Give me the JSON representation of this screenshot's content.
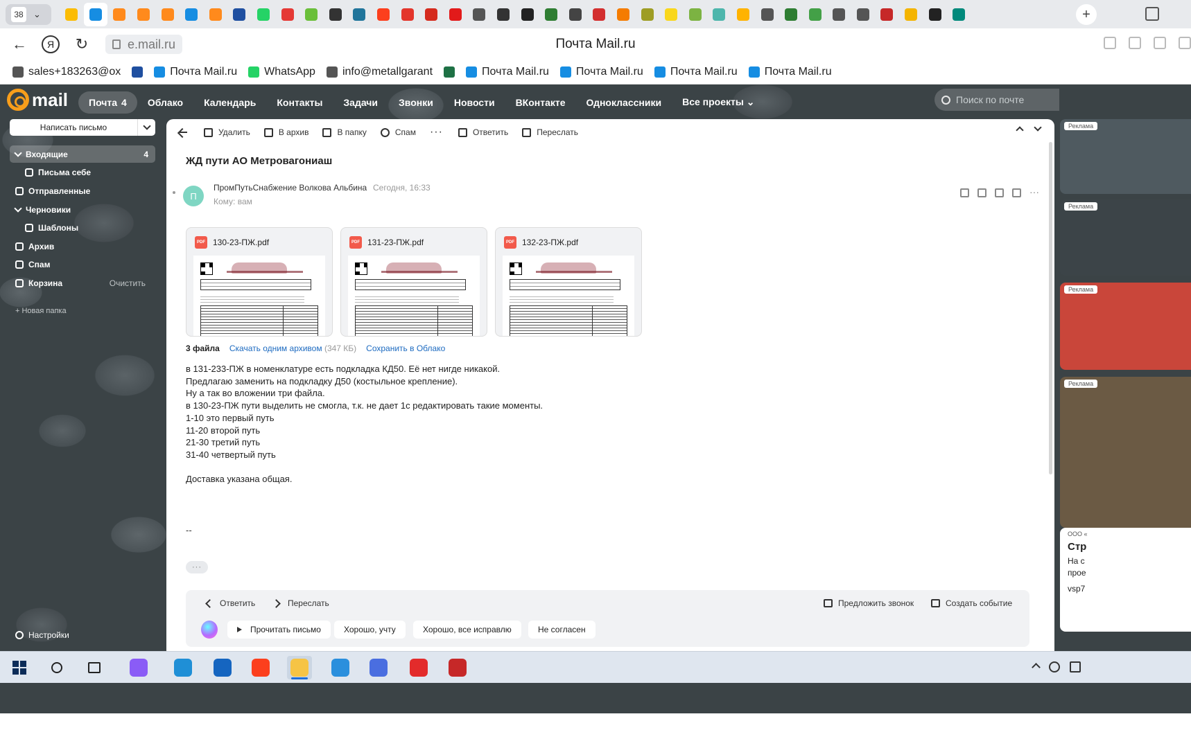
{
  "browser": {
    "tab_count": "38",
    "page_title": "Почта Mail.ru",
    "url": "e.mail.ru",
    "new_tab": "+",
    "tab_icons": [
      {
        "name": "google-drive-icon",
        "color": "#fbbc04"
      },
      {
        "name": "mail-icon",
        "color": "#168de2"
      },
      {
        "name": "cloud-orange-icon",
        "color": "#ff8a1c"
      },
      {
        "name": "cloud-orange-icon",
        "color": "#ff8a1c"
      },
      {
        "name": "cloud-orange-icon",
        "color": "#ff8a1c"
      },
      {
        "name": "mail-icon",
        "color": "#168de2"
      },
      {
        "name": "cloud-orange-icon",
        "color": "#ff8a1c"
      },
      {
        "name": "sg-logo-icon",
        "color": "#1f4fa0"
      },
      {
        "name": "whatsapp-icon",
        "color": "#25d366"
      },
      {
        "name": "map-pin-icon",
        "color": "#e53935"
      },
      {
        "name": "leaf-icon",
        "color": "#6abf3a"
      },
      {
        "name": "t-circle-icon",
        "color": "#333333"
      },
      {
        "name": "wordpress-icon",
        "color": "#21759b"
      },
      {
        "name": "yandex-icon",
        "color": "#fc3f1d"
      },
      {
        "name": "red-app-icon",
        "color": "#e3352b"
      },
      {
        "name": "els-icon",
        "color": "#d52b1e"
      },
      {
        "name": "rzd-icon",
        "color": "#e21a1a"
      },
      {
        "name": "document-icon",
        "color": "#555555"
      },
      {
        "name": "train-icon",
        "color": "#333333"
      },
      {
        "name": "tools-icon",
        "color": "#222222"
      },
      {
        "name": "mtm-icon",
        "color": "#2e7d32"
      },
      {
        "name": "dsp-icon",
        "color": "#444444"
      },
      {
        "name": "brand-icon",
        "color": "#d32f2f"
      },
      {
        "name": "orange-logo-icon",
        "color": "#f57c00"
      },
      {
        "name": "track-icon",
        "color": "#9e9d24"
      },
      {
        "name": "eco-icon",
        "color": "#f9d71c"
      },
      {
        "name": "chat-icon",
        "color": "#7cb342"
      },
      {
        "name": "gear-blue-icon",
        "color": "#4db6ac"
      },
      {
        "name": "image-icon",
        "color": "#ffb300"
      },
      {
        "name": "document-icon",
        "color": "#555555"
      },
      {
        "name": "green-app-icon",
        "color": "#2e7d32"
      },
      {
        "name": "green-diamond-icon",
        "color": "#43a047"
      },
      {
        "name": "document-icon",
        "color": "#555555"
      },
      {
        "name": "document-icon",
        "color": "#555555"
      },
      {
        "name": "globe-icon",
        "color": "#c62828"
      },
      {
        "name": "mail-yellow-icon",
        "color": "#f4b400"
      },
      {
        "name": "circle-icon",
        "color": "#222222"
      },
      {
        "name": "app-icon",
        "color": "#00897b"
      }
    ],
    "bookmarks": [
      {
        "label": "sales+183263@ox",
        "icon": "document-icon",
        "color": "#555555"
      },
      {
        "label": "",
        "icon": "app-icon",
        "color": "#1f4fa0"
      },
      {
        "label": "Почта Mail.ru",
        "icon": "mail-icon",
        "color": "#168de2"
      },
      {
        "label": "WhatsApp",
        "icon": "whatsapp-icon",
        "color": "#25d366"
      },
      {
        "label": "info@metallgarant",
        "icon": "document-icon",
        "color": "#555555"
      },
      {
        "label": "",
        "icon": "excel-icon",
        "color": "#1e7145"
      },
      {
        "label": "Почта Mail.ru",
        "icon": "mail-icon",
        "color": "#168de2"
      },
      {
        "label": "Почта Mail.ru",
        "icon": "mail-icon",
        "color": "#168de2"
      },
      {
        "label": "Почта Mail.ru",
        "icon": "mail-icon",
        "color": "#168de2"
      },
      {
        "label": "Почта Mail.ru",
        "icon": "mail-at-icon",
        "color": "#168de2"
      }
    ]
  },
  "mail": {
    "logo": "mail",
    "nav": [
      {
        "label": "Почта",
        "count": "4",
        "active": true
      },
      {
        "label": "Облако"
      },
      {
        "label": "Календарь"
      },
      {
        "label": "Контакты"
      },
      {
        "label": "Задачи"
      },
      {
        "label": "Звонки"
      },
      {
        "label": "Новости"
      },
      {
        "label": "ВКонтакте"
      },
      {
        "label": "Одноклассники"
      },
      {
        "label": "Все проекты"
      }
    ],
    "search_placeholder": "Поиск по почте",
    "compose_label": "Написать письмо",
    "folders": [
      {
        "label": "Входящие",
        "count": "4",
        "active": true,
        "icon": "chevron-down-icon"
      },
      {
        "label": "Письма себе",
        "sub": true,
        "icon": "self-mail-icon"
      },
      {
        "label": "Отправленные",
        "icon": "sent-icon"
      },
      {
        "label": "Черновики",
        "icon": "chevron-down-icon"
      },
      {
        "label": "Шаблоны",
        "sub": true,
        "icon": "folder-icon"
      },
      {
        "label": "Архив",
        "icon": "archive-icon"
      },
      {
        "label": "Спам",
        "icon": "spam-icon"
      },
      {
        "label": "Корзина",
        "action": "Очистить",
        "icon": "trash-icon"
      }
    ],
    "new_folder": "+ Новая папка",
    "settings": "Настройки",
    "toolbar": {
      "delete": "Удалить",
      "archive": "В архив",
      "to_folder": "В папку",
      "spam": "Спам",
      "more": "···",
      "reply": "Ответить",
      "forward": "Переслать"
    },
    "message": {
      "subject": "ЖД пути АО Метровагониаш",
      "avatar_letter": "П",
      "sender": "ПромПутьСнабжение Волкова Альбина",
      "date": "Сегодня, 16:33",
      "recipient": "Кому: вам",
      "attachments": [
        {
          "name": "130-23-ПЖ.pdf"
        },
        {
          "name": "131-23-ПЖ.pdf"
        },
        {
          "name": "132-23-ПЖ.pdf"
        }
      ],
      "pdf_badge": "PDF",
      "attach_count": "3 файла",
      "download_all": "Скачать одним архивом",
      "archive_size": "(347 КБ)",
      "save_cloud": "Сохранить в Облако",
      "body_lines": [
        "в 131-233-ПЖ в номенклатуре есть подкладка КД50. Её нет нигде никакой.",
        "Предлагаю заменить на подкладку Д50 (костыльное крепление).",
        "Ну а так во вложении три файла.",
        "в 130-23-ПЖ пути выделить не смогла, т.к. не дает 1с редактировать такие моменты.",
        "1-10 это первый путь",
        "11-20 второй путь",
        "21-30 третий путь",
        "31-40 четвертый путь",
        "",
        "Доставка указана общая."
      ],
      "signature": "--",
      "more_quoted": "···"
    },
    "reply_panel": {
      "reply": "Ответить",
      "forward": "Переслать",
      "suggest_call": "Предложить звонок",
      "create_event": "Создать событие",
      "read_aloud": "Прочитать письмо",
      "quick_replies": [
        "Хорошо, учту",
        "Хорошо, все исправлю",
        "Не согласен"
      ]
    },
    "ads": {
      "tag": "Реклама",
      "company": "ООО «",
      "title": "Стр",
      "text1": "На с",
      "text2": "прое",
      "link": "vsp7"
    }
  },
  "taskbar": {
    "items": [
      {
        "name": "windows-start-icon"
      },
      {
        "name": "search-icon"
      },
      {
        "name": "task-view-icon"
      },
      {
        "name": "alice-icon",
        "color": "#8a5cf6"
      },
      {
        "name": "edge-icon",
        "color": "#1f8fd6"
      },
      {
        "name": "mail-app-icon",
        "color": "#1565c0"
      },
      {
        "name": "yandex-browser-icon",
        "color": "#fc3f1d"
      },
      {
        "name": "file-explorer-icon",
        "color": "#f6c445",
        "active": true
      },
      {
        "name": "internet-explorer-icon",
        "color": "#2a8fdd"
      },
      {
        "name": "app-hex-icon",
        "color": "#4a6ee0"
      },
      {
        "name": "yandex-y-icon",
        "color": "#e32b2b"
      },
      {
        "name": "red-app-icon",
        "color": "#c62828"
      }
    ]
  }
}
